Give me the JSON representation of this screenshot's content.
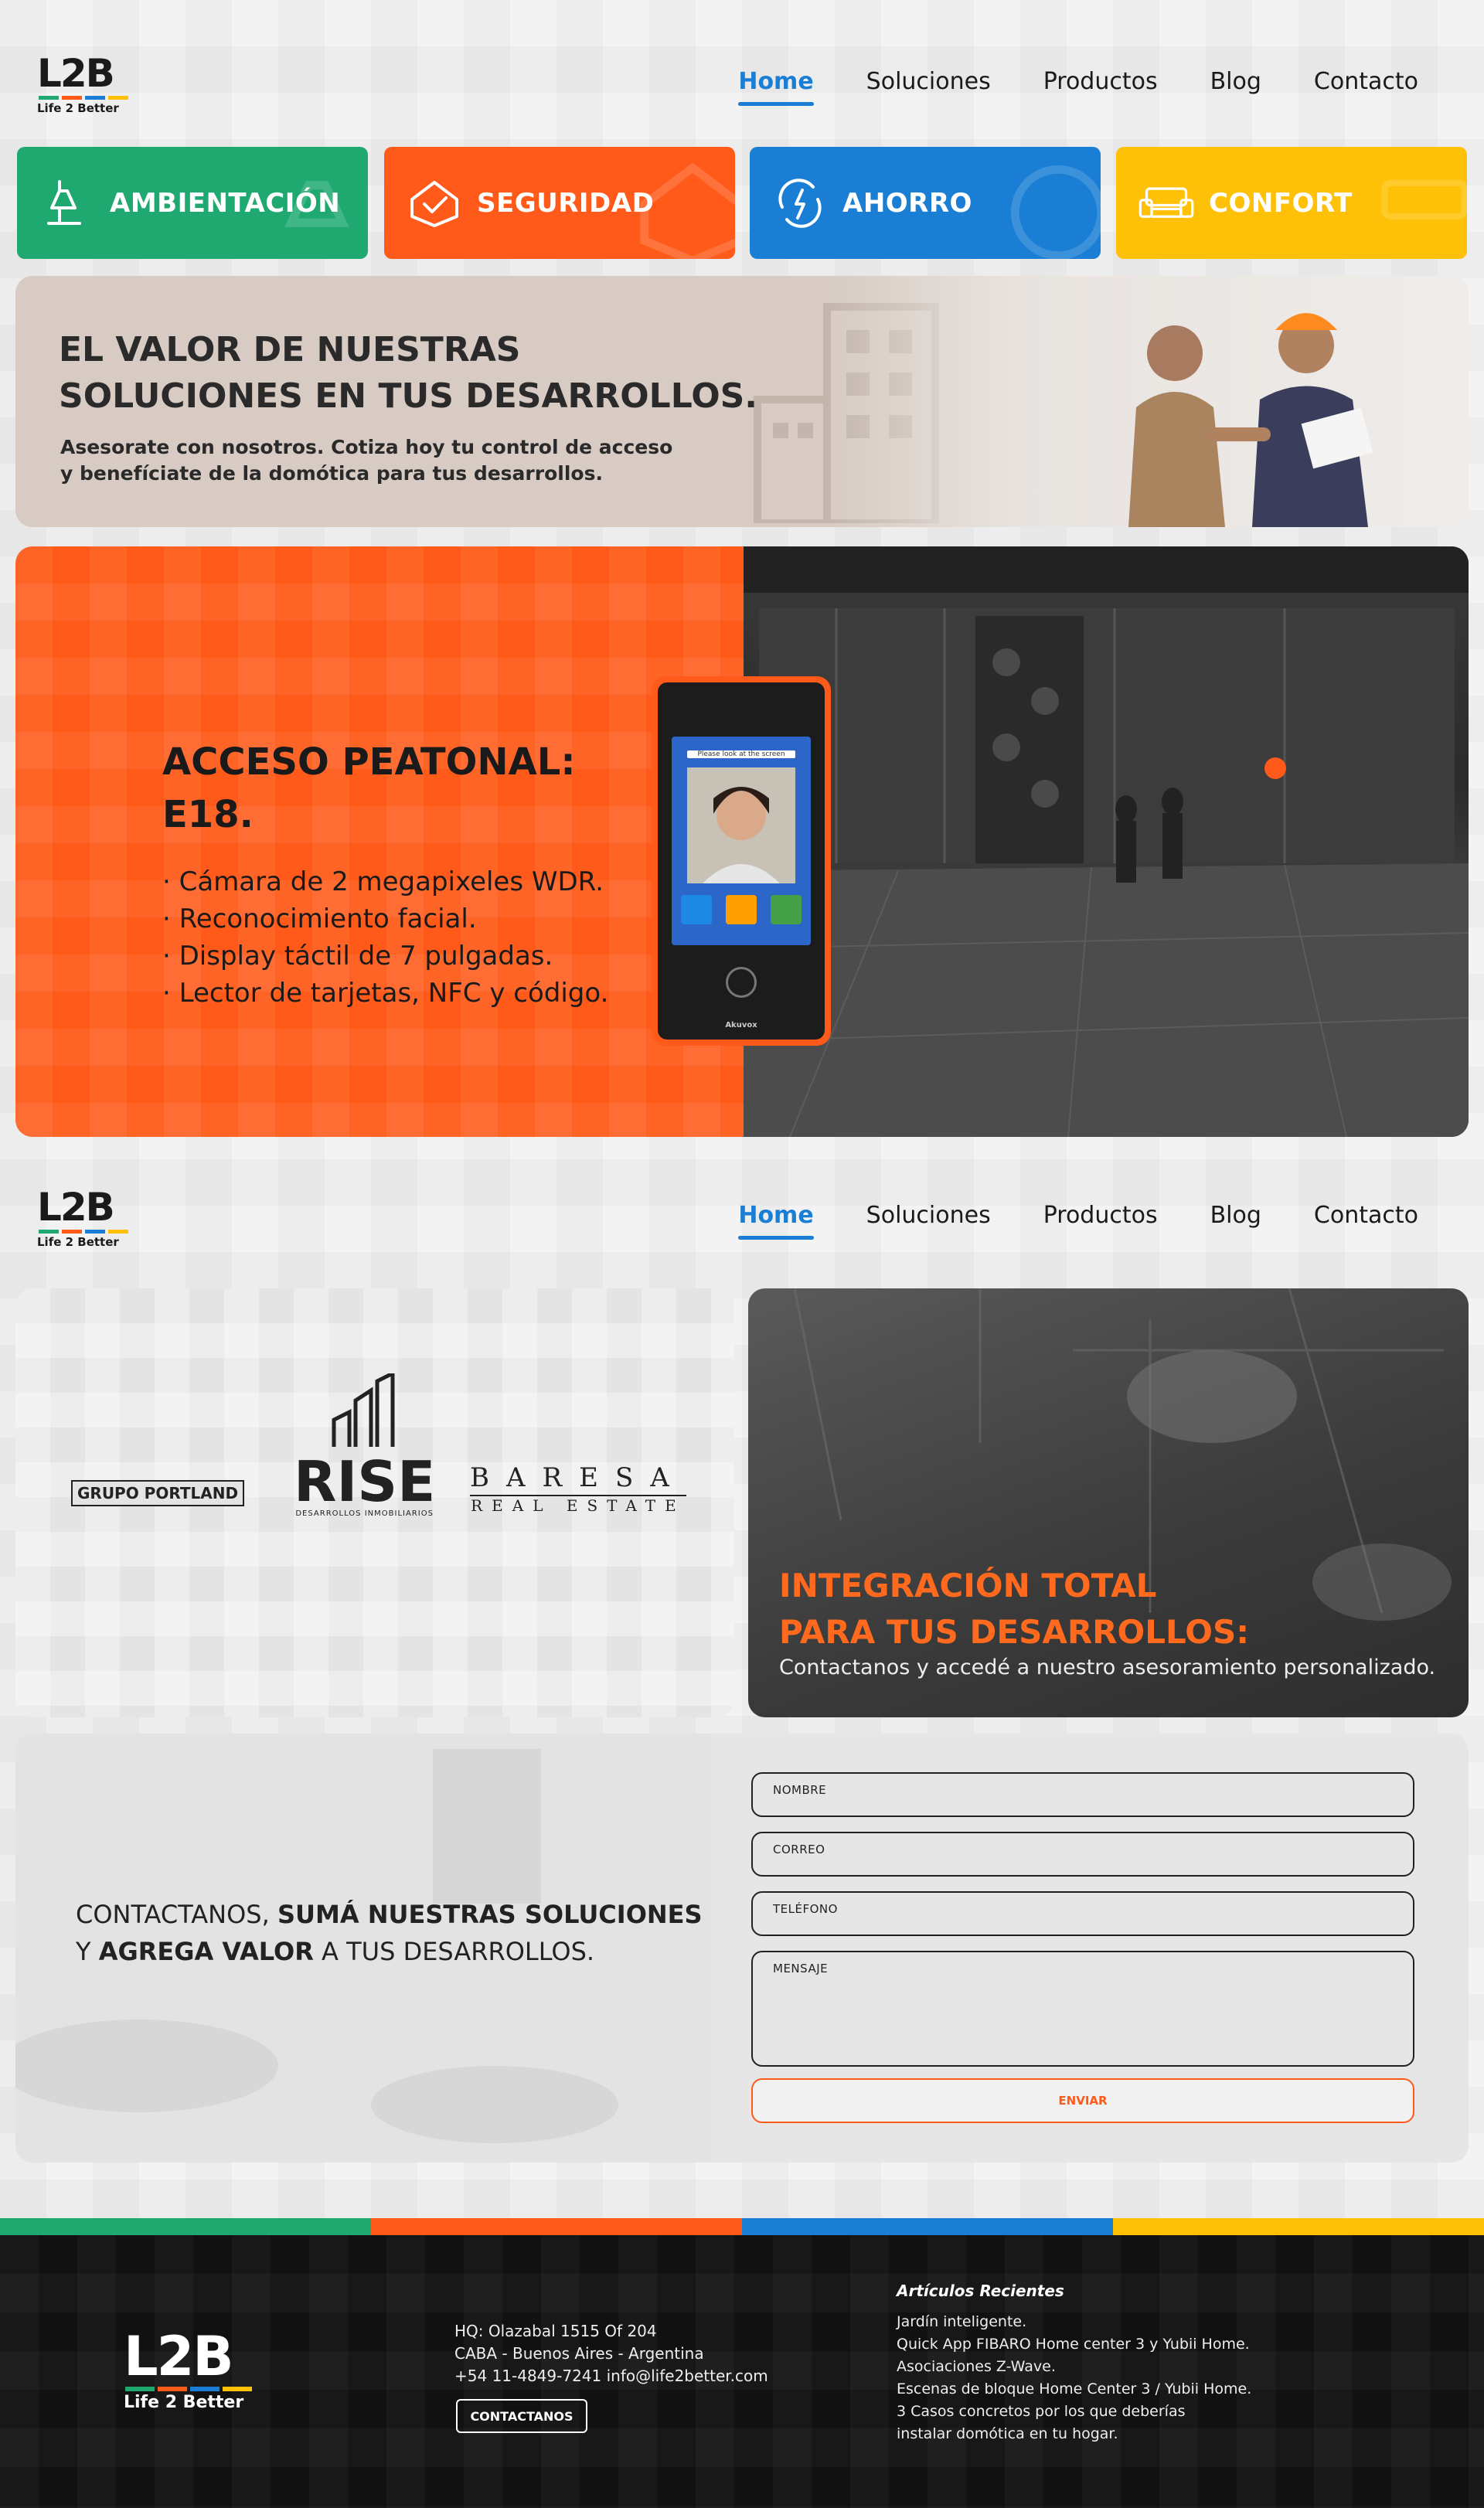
{
  "brand": {
    "mark": "L2B",
    "tagline": "Life 2 Better",
    "colors": {
      "green": "#1fa971",
      "orange": "#ff5a1a",
      "blue": "#1a7fd4",
      "yellow": "#ffc107"
    }
  },
  "nav": {
    "items": [
      "Home",
      "Soluciones",
      "Productos",
      "Blog",
      "Contacto"
    ],
    "active": "Home"
  },
  "categories": [
    {
      "label": "AMBIENTACIÓN",
      "icon": "lamp-icon",
      "color": "#1fa971"
    },
    {
      "label": "SEGURIDAD",
      "icon": "shield-check-icon",
      "color": "#ff5a1a"
    },
    {
      "label": "AHORRO",
      "icon": "energy-cycle-icon",
      "color": "#1a7fd4"
    },
    {
      "label": "CONFORT",
      "icon": "sofa-icon",
      "color": "#ffc107"
    }
  ],
  "hero": {
    "title_line1": "EL VALOR DE NUESTRAS",
    "title_line2": "SOLUCIONES EN TUS DESARROLLOS.",
    "text_line1": "Asesorate con nosotros. Cotiza hoy tu control de acceso",
    "text_line2": "y benefíciate de la domótica para tus desarrollos."
  },
  "product": {
    "title_line1": "ACCESO PEATONAL:",
    "title_line2": "E18.",
    "features": [
      "· Cámara de 2 megapixeles WDR.",
      "· Reconocimiento facial.",
      "· Display táctil de 7 pulgadas.",
      "· Lector de tarjetas, NFC y código."
    ],
    "device_brand": "Akuvox",
    "device_prompt": "Please look at the screen"
  },
  "clients": [
    "GRUPO PORTLAND",
    "RISE",
    "DESARROLLOS INMOBILIARIOS",
    "BARESA",
    "REAL ESTATE"
  ],
  "integration": {
    "title_line1": "INTEGRACIÓN TOTAL",
    "title_line2": "PARA TUS DESARROLLOS:",
    "text": "Contactanos y accedé a nuestro asesoramiento personalizado."
  },
  "contact": {
    "msg_a": "CONTACTANOS, ",
    "msg_b": "SUMÁ NUESTRAS SOLUCIONES",
    "msg_c": "Y ",
    "msg_d": "AGREGA VALOR",
    "msg_e": " A TUS DESARROLLOS.",
    "fields": {
      "name": "NOMBRE",
      "email": "CORREO",
      "phone": "TELÉFONO",
      "message": "MENSAJE"
    },
    "send": "ENVIAR"
  },
  "footer": {
    "address_line1": "HQ: Olazabal 1515 Of 204",
    "address_line2": "CABA - Buenos Aires - Argentina",
    "address_line3": "+54 11-4849-7241 info@life2better.com",
    "button": "CONTACTANOS",
    "articles_title": "Artículos Recientes",
    "articles": [
      "Jardín inteligente.",
      "Quick App FIBARO Home center 3 y Yubii Home.",
      "Asociaciones Z-Wave.",
      "Escenas de bloque Home Center 3 / Yubii Home.",
      "3 Casos concretos por los que deberías",
      "instalar domótica en tu hogar."
    ]
  }
}
